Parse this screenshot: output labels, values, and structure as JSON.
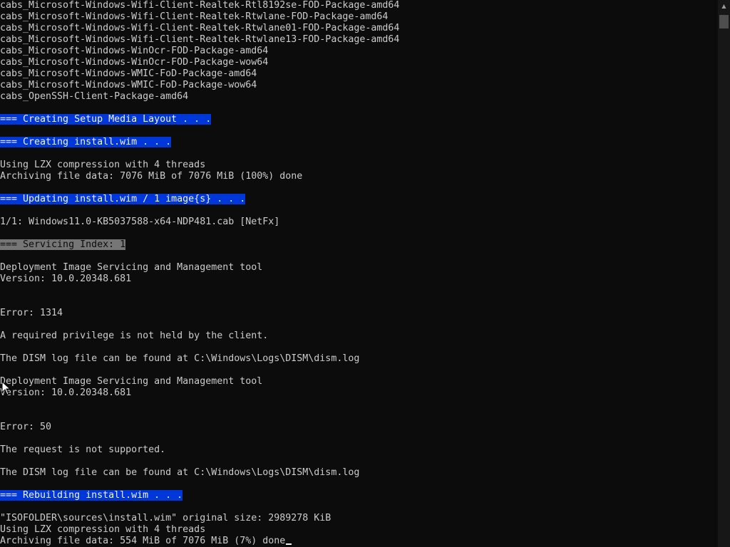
{
  "console": {
    "lines": [
      {
        "text": "cabs_Microsoft-Windows-Wifi-Client-Realtek-Rtl8192se-FOD-Package-amd64",
        "style": "normal"
      },
      {
        "text": "cabs_Microsoft-Windows-Wifi-Client-Realtek-Rtwlane-FOD-Package-amd64",
        "style": "normal"
      },
      {
        "text": "cabs_Microsoft-Windows-Wifi-Client-Realtek-Rtwlane01-FOD-Package-amd64",
        "style": "normal"
      },
      {
        "text": "cabs_Microsoft-Windows-Wifi-Client-Realtek-Rtwlane13-FOD-Package-amd64",
        "style": "normal"
      },
      {
        "text": "cabs_Microsoft-Windows-WinOcr-FOD-Package-amd64",
        "style": "normal"
      },
      {
        "text": "cabs_Microsoft-Windows-WinOcr-FOD-Package-wow64",
        "style": "normal"
      },
      {
        "text": "cabs_Microsoft-Windows-WMIC-FoD-Package-amd64",
        "style": "normal"
      },
      {
        "text": "cabs_Microsoft-Windows-WMIC-FoD-Package-wow64",
        "style": "normal"
      },
      {
        "text": "cabs_OpenSSH-Client-Package-amd64",
        "style": "normal"
      },
      {
        "text": "",
        "style": "normal"
      },
      {
        "text": "=== Creating Setup Media Layout . . .",
        "style": "highlight-blue"
      },
      {
        "text": "",
        "style": "normal"
      },
      {
        "text": "=== Creating install.wim . . .",
        "style": "highlight-blue"
      },
      {
        "text": "",
        "style": "normal"
      },
      {
        "text": "Using LZX compression with 4 threads",
        "style": "normal"
      },
      {
        "text": "Archiving file data: 7076 MiB of 7076 MiB (100%) done",
        "style": "normal"
      },
      {
        "text": "",
        "style": "normal"
      },
      {
        "text": "=== Updating install.wim / 1 image{s} . . .",
        "style": "highlight-blue"
      },
      {
        "text": "",
        "style": "normal"
      },
      {
        "text": "1/1: Windows11.0-KB5037588-x64-NDP481.cab [NetFx]",
        "style": "normal"
      },
      {
        "text": "",
        "style": "normal"
      },
      {
        "text": "=== Servicing Index: 1",
        "style": "highlight-gray"
      },
      {
        "text": "",
        "style": "normal"
      },
      {
        "text": "Deployment Image Servicing and Management tool",
        "style": "normal"
      },
      {
        "text": "Version: 10.0.20348.681",
        "style": "normal"
      },
      {
        "text": "",
        "style": "normal"
      },
      {
        "text": "",
        "style": "normal"
      },
      {
        "text": "Error: 1314",
        "style": "normal"
      },
      {
        "text": "",
        "style": "normal"
      },
      {
        "text": "A required privilege is not held by the client.",
        "style": "normal"
      },
      {
        "text": "",
        "style": "normal"
      },
      {
        "text": "The DISM log file can be found at C:\\Windows\\Logs\\DISM\\dism.log",
        "style": "normal"
      },
      {
        "text": "",
        "style": "normal"
      },
      {
        "text": "Deployment Image Servicing and Management tool",
        "style": "normal"
      },
      {
        "text": "Version: 10.0.20348.681",
        "style": "normal"
      },
      {
        "text": "",
        "style": "normal"
      },
      {
        "text": "",
        "style": "normal"
      },
      {
        "text": "Error: 50",
        "style": "normal"
      },
      {
        "text": "",
        "style": "normal"
      },
      {
        "text": "The request is not supported.",
        "style": "normal"
      },
      {
        "text": "",
        "style": "normal"
      },
      {
        "text": "The DISM log file can be found at C:\\Windows\\Logs\\DISM\\dism.log",
        "style": "normal"
      },
      {
        "text": "",
        "style": "normal"
      },
      {
        "text": "=== Rebuilding install.wim . . .",
        "style": "highlight-blue"
      },
      {
        "text": "",
        "style": "normal"
      },
      {
        "text": "\"ISOFOLDER\\sources\\install.wim\" original size: 2989278 KiB",
        "style": "normal"
      },
      {
        "text": "Using LZX compression with 4 threads",
        "style": "normal"
      },
      {
        "text": "Archiving file data: 554 MiB of 7076 MiB (7%) done",
        "style": "normal",
        "cursor": true
      }
    ]
  },
  "colors": {
    "background": "#0c0c0c",
    "text": "#cccccc",
    "highlight_blue": "#0037da",
    "highlight_gray": "#767676",
    "scrollbar_track": "#171717",
    "scrollbar_thumb": "#4d4d4d"
  },
  "icons": {
    "scroll_up": "scroll-up-arrow-icon",
    "pointer": "mouse-pointer-icon"
  }
}
